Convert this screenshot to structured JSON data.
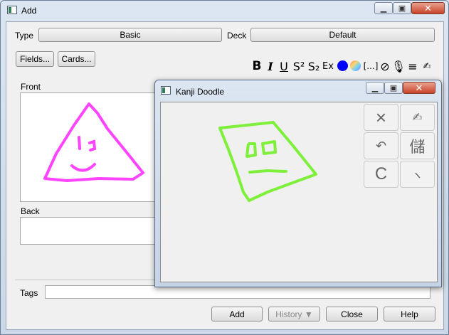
{
  "window": {
    "title": "Add"
  },
  "type_row": {
    "type_label": "Type",
    "type_value": "Basic",
    "deck_label": "Deck",
    "deck_value": "Default"
  },
  "buttons_row": {
    "fields": "Fields...",
    "cards": "Cards..."
  },
  "toolbar": {
    "bold": "B",
    "italic": "I",
    "underline": "U",
    "superscript": "S²",
    "subscript": "S₂",
    "clear_format": "Ex",
    "text_color": "#0000ff",
    "cloze": "[...]"
  },
  "fields": [
    {
      "label": "Front",
      "doodle_color": "#ff44ff"
    },
    {
      "label": "Back"
    }
  ],
  "tags": {
    "label": "Tags",
    "value": ""
  },
  "bottom": {
    "add": "Add",
    "history": "History ▼",
    "close": "Close",
    "help": "Help"
  },
  "kanji_doodle": {
    "title": "Kanji Doodle",
    "stroke_color": "#7ef03a",
    "pad": [
      "×",
      "✍",
      "↶",
      "儲",
      "C",
      "ヽ"
    ]
  }
}
